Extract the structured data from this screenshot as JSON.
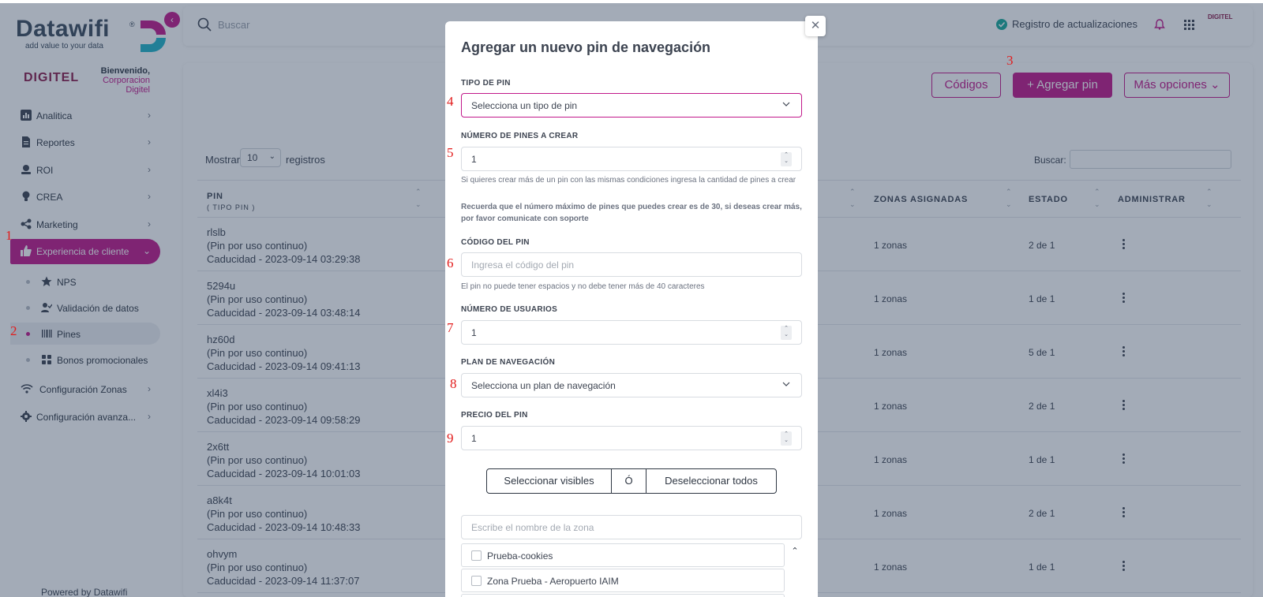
{
  "sidebar": {
    "logo": {
      "word": "Datawifi",
      "sup": "®",
      "tagline": "add value to your data"
    },
    "brand": "DIGITEL",
    "welcome": {
      "line1": "Bienvenido,",
      "line2": "Corporacion",
      "line3": "Digitel"
    },
    "items": [
      {
        "label": "Analitica",
        "icon": "bar-chart-icon"
      },
      {
        "label": "Reportes",
        "icon": "document-icon"
      },
      {
        "label": "ROI",
        "icon": "user-gauge-icon"
      },
      {
        "label": "CREA",
        "icon": "lightbulb-icon"
      },
      {
        "label": "Marketing",
        "icon": "share-icon"
      },
      {
        "label": "Experiencia de cliente",
        "icon": "thumbs-up-icon"
      }
    ],
    "subitems": [
      {
        "label": "NPS",
        "icon": "star-icon"
      },
      {
        "label": "Validación de datos",
        "icon": "user-check-icon"
      },
      {
        "label": "Pines",
        "icon": "barcode-icon"
      },
      {
        "label": "Bonos promocionales",
        "icon": "grid-icon"
      }
    ],
    "bottom_items": [
      {
        "label": "Configuración Zonas",
        "icon": "wifi-icon"
      },
      {
        "label": "Configuración avanza...",
        "icon": "gear-icon"
      }
    ],
    "powered": "Powered by Datawifi"
  },
  "topbar": {
    "search_placeholder": "Buscar",
    "updates": "Registro de actualizaciones",
    "mini_brand": "DIGITEL"
  },
  "toolbar": {
    "codes": "Códigos",
    "add_pin": "+ Agregar pin",
    "more": "Más opciones ⌄"
  },
  "table": {
    "show_label": "Mostrar",
    "show_value": "10",
    "show_after": "registros",
    "search_label": "Buscar:",
    "columns": {
      "pin": "PIN",
      "pin_sub": "( TIPO PIN )",
      "zones": "ZONAS ASIGNADAS",
      "status": "ESTADO",
      "admin": "ADMINISTRAR"
    },
    "rows": [
      {
        "code": "rlslb",
        "type": "(Pin por uso continuo)",
        "expiry": "Caducidad - 2023-09-14 03:29:38",
        "zones": "1 zonas",
        "status": "2 de 1"
      },
      {
        "code": "5294u",
        "type": "(Pin por uso continuo)",
        "expiry": "Caducidad - 2023-09-14 03:48:14",
        "zones": "1 zonas",
        "status": "1 de 1"
      },
      {
        "code": "hz60d",
        "type": "(Pin por uso continuo)",
        "expiry": "Caducidad - 2023-09-14 09:41:13",
        "zones": "1 zonas",
        "status": "5 de 1"
      },
      {
        "code": "xl4i3",
        "type": "(Pin por uso continuo)",
        "expiry": "Caducidad - 2023-09-14 09:58:29",
        "zones": "1 zonas",
        "status": "2 de 1"
      },
      {
        "code": "2x6tt",
        "type": "(Pin por uso continuo)",
        "expiry": "Caducidad - 2023-09-14 10:01:03",
        "zones": "1 zonas",
        "status": "1 de 1"
      },
      {
        "code": "a8k4t",
        "type": "(Pin por uso continuo)",
        "expiry": "Caducidad - 2023-09-14 10:48:33",
        "zones": "1 zonas",
        "status": "2 de 1"
      },
      {
        "code": "ohvym",
        "type": "(Pin por uso continuo)",
        "expiry": "Caducidad - 2023-09-14 11:37:07",
        "zones": "1 zonas",
        "status": "1 de 1"
      }
    ]
  },
  "modal": {
    "title": "Agregar un nuevo pin de navegación",
    "pin_type_label": "TIPO DE PIN",
    "pin_type_placeholder": "Selecciona un tipo de pin",
    "count_label": "NÚMERO DE PINES A CREAR",
    "count_value": "1",
    "count_help": "Si quieres crear más de un pin con las mismas condiciones ingresa la cantidad de pines a crear",
    "count_note": "Recuerda que el número máximo de pines que puedes crear es de 30, si deseas crear más, por favor comunicate con soporte",
    "code_label": "CÓDIGO DEL PIN",
    "code_placeholder": "Ingresa el código del pin",
    "code_help": "El pin no puede tener espacios y no debe tener más de 40 caracteres",
    "users_label": "NÚMERO DE USUARIOS",
    "users_value": "1",
    "plan_label": "PLAN DE NAVEGACIÓN",
    "plan_placeholder": "Selecciona un plan de navegación",
    "price_label": "PRECIO DEL PIN",
    "price_value": "1",
    "select_visible": "Seleccionar visibles",
    "or": "Ó",
    "deselect_all": "Deseleccionar todos",
    "zone_search_placeholder": "Escribe el nombre de la zona",
    "zones": [
      "Prueba-cookies",
      "Zona Prueba - Aeropuerto IAIM"
    ]
  },
  "markers": [
    "1",
    "2",
    "3",
    "4",
    "5",
    "6",
    "7",
    "8",
    "9"
  ],
  "colors": {
    "accent": "#c1188a",
    "annotation": "#e21c1c",
    "overlay": "rgba(36,54,84,0.42)"
  }
}
